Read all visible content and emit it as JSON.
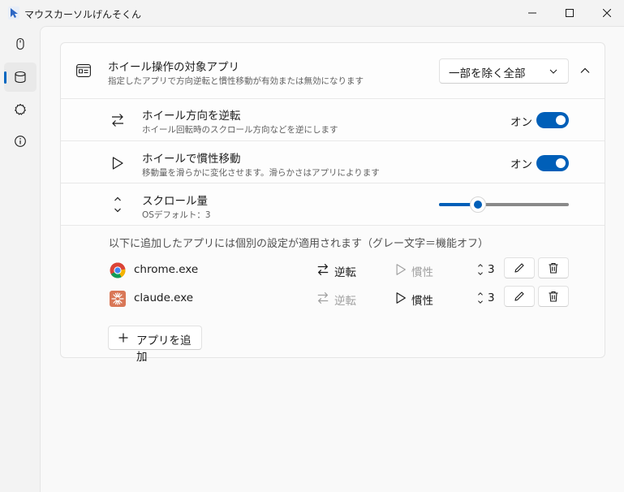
{
  "window": {
    "title": "マウスカーソルげんそくん"
  },
  "sidebar": {
    "items": [
      {
        "icon": "mouse-icon",
        "active": false
      },
      {
        "icon": "database-icon",
        "active": true
      },
      {
        "icon": "gear-icon",
        "active": false
      },
      {
        "icon": "info-icon",
        "active": false
      }
    ]
  },
  "target_apps": {
    "title": "ホイール操作の対象アプリ",
    "description": "指定したアプリで方向逆転と慣性移動が有効または無効になります",
    "dropdown_value": "一部を除く全部"
  },
  "reverse": {
    "title": "ホイール方向を逆転",
    "description": "ホイール回転時のスクロール方向などを逆にします",
    "state_label": "オン",
    "enabled": true
  },
  "inertia": {
    "title": "ホイールで慣性移動",
    "description": "移動量を滑らかに変化させます。滑らかさはアプリによります",
    "state_label": "オン",
    "enabled": true
  },
  "scroll_amount": {
    "title": "スクロール量",
    "description": "OSデフォルト：3",
    "level": 3
  },
  "apps_note": "以下に追加したアプリには個別の設定が適用されます（グレー文字＝機能オフ）",
  "apps": [
    {
      "name": "chrome.exe",
      "reverse_label": "逆転",
      "reverse_on": true,
      "inertia_label": "慣性",
      "inertia_on": false,
      "scroll": "3"
    },
    {
      "name": "claude.exe",
      "reverse_label": "逆転",
      "reverse_on": false,
      "inertia_label": "慣性",
      "inertia_on": true,
      "scroll": "3"
    }
  ],
  "add_app_label": "アプリを追加",
  "colors": {
    "accent": "#005fb8",
    "disabled_text": "#a0a0a0"
  }
}
